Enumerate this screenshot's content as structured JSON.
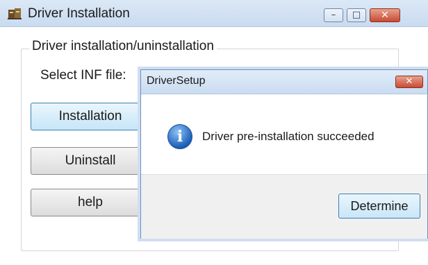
{
  "main_window": {
    "title": "Driver Installation",
    "controls": {
      "minimize_glyph": "–",
      "maximize_glyph": "□",
      "close_glyph": "✕"
    },
    "group_label": "Driver installation/uninstallation",
    "inf_label": "Select INF file:",
    "buttons": {
      "install": "Installation",
      "uninstall": "Uninstall",
      "help": "help"
    }
  },
  "dialog": {
    "title": "DriverSetup",
    "close_glyph": "✕",
    "icon_glyph": "i",
    "message": "Driver pre-installation succeeded",
    "ok_label": "Determine"
  },
  "colors": {
    "titlebar": "#c9dbf0",
    "close_button": "#c74b34",
    "info_icon": "#1b5fb9",
    "focus_border": "#3c7fb1"
  }
}
